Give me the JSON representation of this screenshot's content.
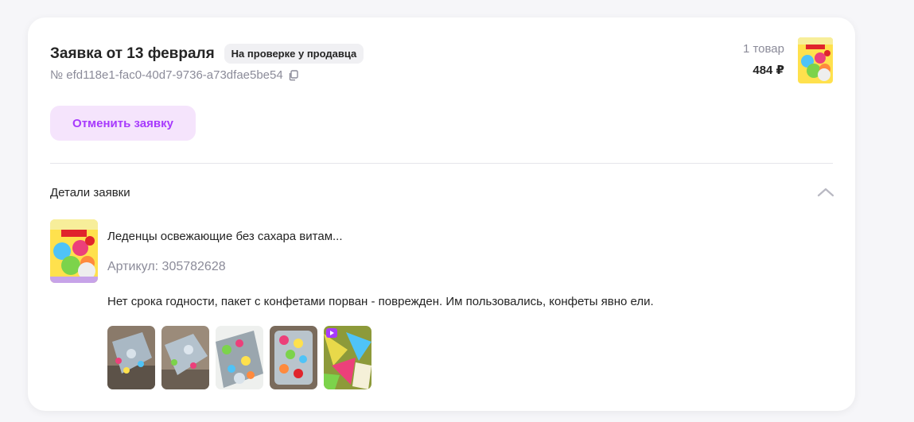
{
  "header": {
    "title": "Заявка от 13 февраля",
    "status": "На проверке у продавца",
    "order_id": "№ efd118e1-fac0-40d7-9736-a73dfae5be54",
    "copy_icon": "copy-icon"
  },
  "summary": {
    "items_count": "1 товар",
    "total": "484 ₽"
  },
  "actions": {
    "cancel_label": "Отменить заявку"
  },
  "details": {
    "header": "Детали заявки",
    "toggle_icon": "chevron-up-icon",
    "product_name": "Леденцы освежающие без сахара витам...",
    "article": "Артикул: 305782628",
    "comment": "Нет срока годности, пакет с конфетами порван - поврежден. Им пользовались, конфеты явно ели.",
    "photos": [
      "photo",
      "photo",
      "photo",
      "photo",
      "video"
    ]
  },
  "colors": {
    "accent": "#a73afd",
    "accent_bg": "#f5e4fc",
    "muted_text": "#8b8b99",
    "badge_bg": "#f0f0f3"
  }
}
